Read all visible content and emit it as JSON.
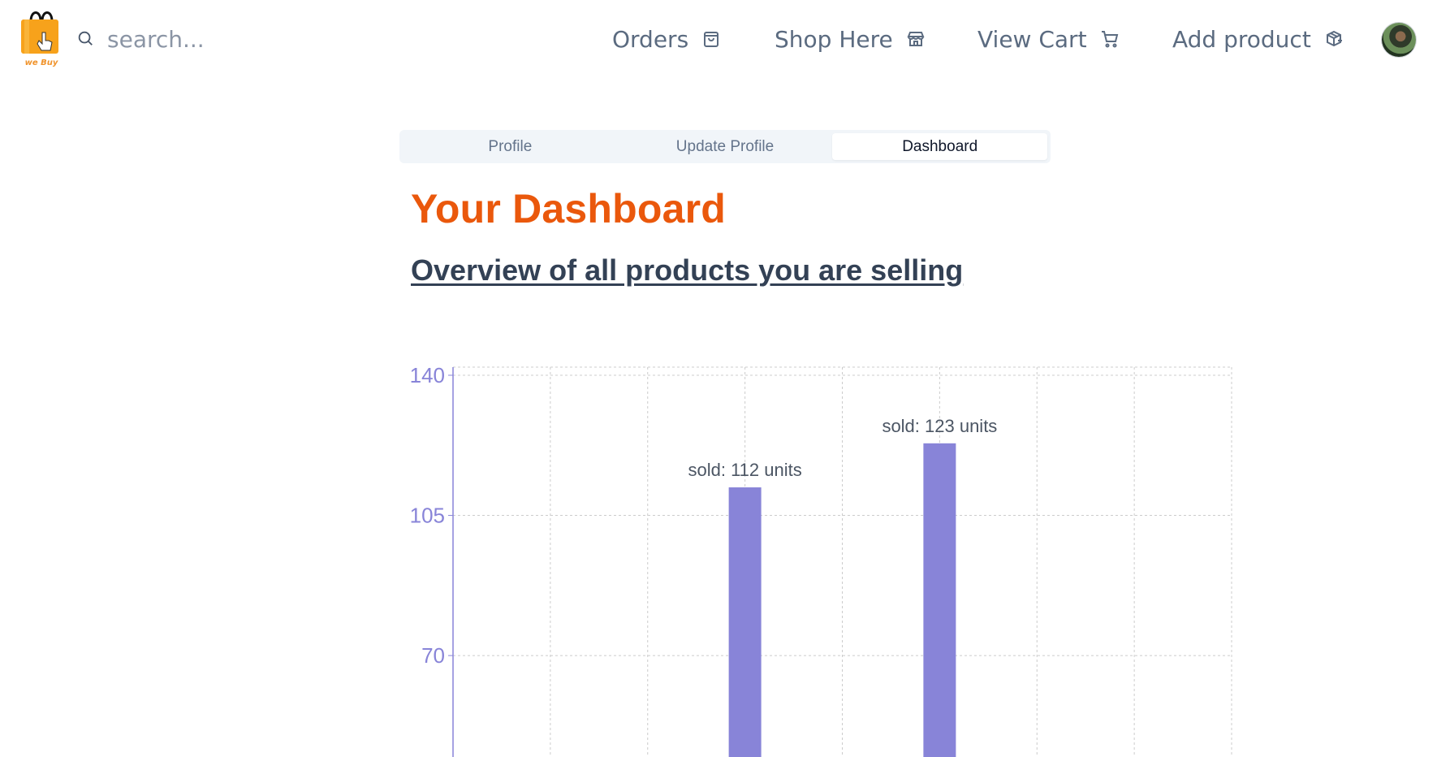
{
  "brand": {
    "name": "we Buy",
    "logo_color": "#f7a21b"
  },
  "search": {
    "placeholder": "search...",
    "value": ""
  },
  "nav": {
    "items": [
      {
        "label": "Orders",
        "icon": "shopping-bag-icon"
      },
      {
        "label": "Shop Here",
        "icon": "store-icon"
      },
      {
        "label": "View Cart",
        "icon": "shopping-cart-icon"
      },
      {
        "label": "Add product",
        "icon": "package-plus-icon"
      }
    ],
    "avatar": "user-avatar"
  },
  "tabs": [
    {
      "label": "Profile",
      "active": false
    },
    {
      "label": "Update Profile",
      "active": false
    },
    {
      "label": "Dashboard",
      "active": true
    }
  ],
  "dashboard": {
    "title": "Your Dashboard",
    "subtitle": "Overview of all products you are selling"
  },
  "colors": {
    "accent": "#ea580c",
    "bar": "#8884d8",
    "text": "#334155"
  },
  "chart_data": {
    "type": "bar",
    "title": "",
    "xlabel": "",
    "ylabel": "",
    "ylim": [
      0,
      140
    ],
    "yticks": [
      70,
      105,
      140
    ],
    "categories": [
      "",
      "",
      "",
      ""
    ],
    "values": [
      0,
      112,
      123,
      0
    ],
    "bar_labels": [
      "",
      "sold: 112 units",
      "sold: 123 units",
      ""
    ],
    "grid": true
  }
}
